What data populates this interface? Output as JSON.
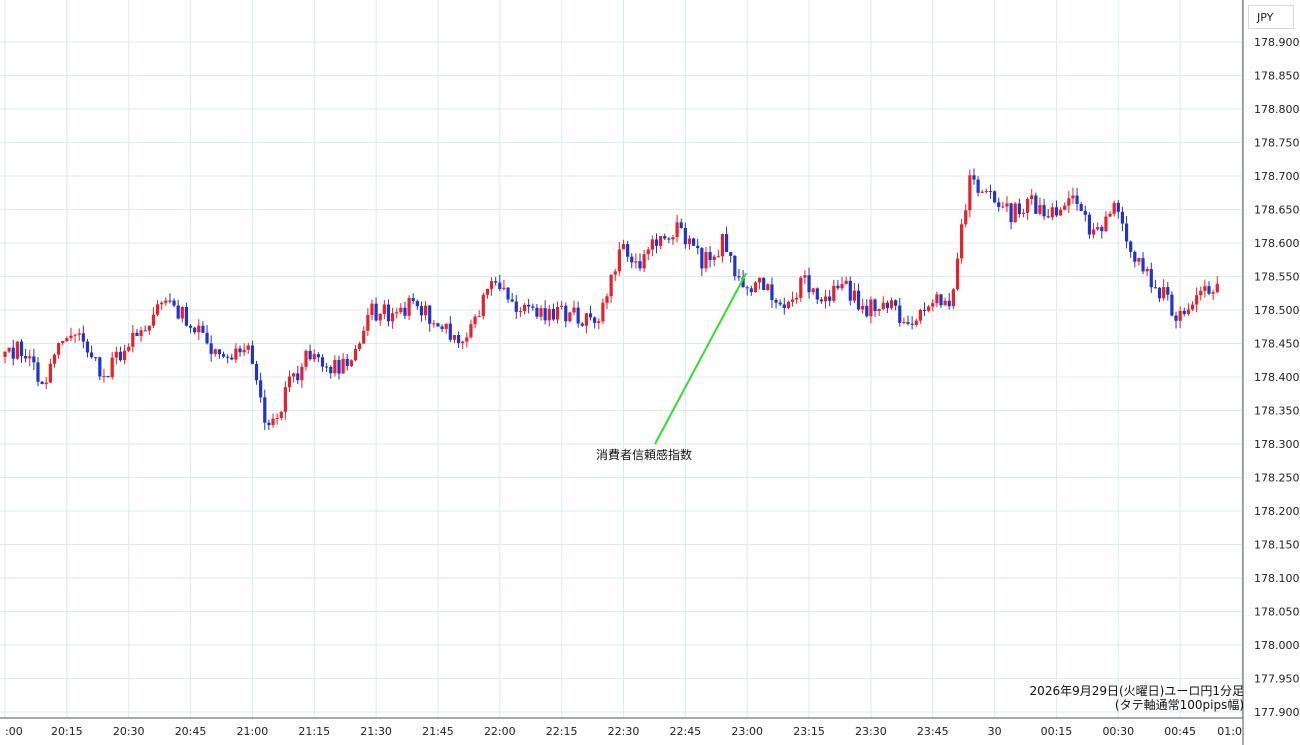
{
  "chart_data": {
    "type": "candlestick",
    "y_unit_label": "JPY",
    "ylim": [
      177.9,
      178.925
    ],
    "y_ticks": [
      "178.900",
      "178.850",
      "178.800",
      "178.750",
      "178.700",
      "178.650",
      "178.600",
      "178.550",
      "178.500",
      "178.450",
      "178.400",
      "178.350",
      "178.300",
      "178.250",
      "178.200",
      "178.150",
      "178.100",
      "178.050",
      "178.000",
      "177.950",
      "177.900"
    ],
    "x_ticks": [
      ":00",
      "20:15",
      "20:30",
      "20:45",
      "21:00",
      "21:15",
      "21:30",
      "21:45",
      "22:00",
      "22:15",
      "22:30",
      "22:45",
      "23:00",
      "23:15",
      "23:30",
      "23:45",
      "30",
      "00:15",
      "00:30",
      "00:45",
      "01:0"
    ],
    "up_color": "#e8202a",
    "down_color": "#2233cc",
    "annotation": {
      "label": "消費者信頼感指数",
      "time": "23:00",
      "price": 178.555,
      "line_color": "#33dd33"
    },
    "caption_line1": "2026年9月29日(火曜日)ユーロ円1分足",
    "caption_line2": "(タテ軸通常100pips幅)",
    "series": [
      {
        "time": "20:00",
        "close": 178.43
      },
      {
        "time": "20:05",
        "close": 178.44
      },
      {
        "time": "20:10",
        "close": 178.39
      },
      {
        "time": "20:15",
        "close": 178.46
      },
      {
        "time": "20:20",
        "close": 178.455
      },
      {
        "time": "20:25",
        "close": 178.4
      },
      {
        "time": "20:30",
        "close": 178.45
      },
      {
        "time": "20:35",
        "close": 178.48
      },
      {
        "time": "20:40",
        "close": 178.505
      },
      {
        "time": "20:45",
        "close": 178.49
      },
      {
        "time": "20:50",
        "close": 178.45
      },
      {
        "time": "20:55",
        "close": 178.42
      },
      {
        "time": "21:00",
        "close": 178.44
      },
      {
        "time": "21:05",
        "close": 178.32
      },
      {
        "time": "21:10",
        "close": 178.39
      },
      {
        "time": "21:15",
        "close": 178.44
      },
      {
        "time": "21:20",
        "close": 178.41
      },
      {
        "time": "21:25",
        "close": 178.42
      },
      {
        "time": "21:30",
        "close": 178.5
      },
      {
        "time": "21:35",
        "close": 178.49
      },
      {
        "time": "21:40",
        "close": 178.51
      },
      {
        "time": "21:45",
        "close": 178.49
      },
      {
        "time": "21:50",
        "close": 178.45
      },
      {
        "time": "21:55",
        "close": 178.49
      },
      {
        "time": "22:00",
        "close": 178.555
      },
      {
        "time": "22:05",
        "close": 178.495
      },
      {
        "time": "22:10",
        "close": 178.49
      },
      {
        "time": "22:15",
        "close": 178.5
      },
      {
        "time": "22:20",
        "close": 178.49
      },
      {
        "time": "22:25",
        "close": 178.49
      },
      {
        "time": "22:30",
        "close": 178.59
      },
      {
        "time": "22:35",
        "close": 178.565
      },
      {
        "time": "22:40",
        "close": 178.61
      },
      {
        "time": "22:45",
        "close": 178.62
      },
      {
        "time": "22:50",
        "close": 178.57
      },
      {
        "time": "22:55",
        "close": 178.6
      },
      {
        "time": "23:00",
        "close": 178.54
      },
      {
        "time": "23:05",
        "close": 178.535
      },
      {
        "time": "23:10",
        "close": 178.51
      },
      {
        "time": "23:15",
        "close": 178.54
      },
      {
        "time": "23:20",
        "close": 178.52
      },
      {
        "time": "23:25",
        "close": 178.53
      },
      {
        "time": "23:30",
        "close": 178.5
      },
      {
        "time": "23:35",
        "close": 178.51
      },
      {
        "time": "23:40",
        "close": 178.48
      },
      {
        "time": "23:45",
        "close": 178.52
      },
      {
        "time": "23:50",
        "close": 178.5
      },
      {
        "time": "23:55",
        "close": 178.69
      },
      {
        "time": "00:00",
        "close": 178.67
      },
      {
        "time": "00:05",
        "close": 178.64
      },
      {
        "time": "00:10",
        "close": 178.66
      },
      {
        "time": "00:15",
        "close": 178.64
      },
      {
        "time": "00:20",
        "close": 178.67
      },
      {
        "time": "00:25",
        "close": 178.615
      },
      {
        "time": "00:30",
        "close": 178.65
      },
      {
        "time": "00:35",
        "close": 178.58
      },
      {
        "time": "00:40",
        "close": 178.54
      },
      {
        "time": "00:45",
        "close": 178.495
      },
      {
        "time": "00:50",
        "close": 178.52
      },
      {
        "time": "00:55",
        "close": 178.54
      }
    ]
  }
}
